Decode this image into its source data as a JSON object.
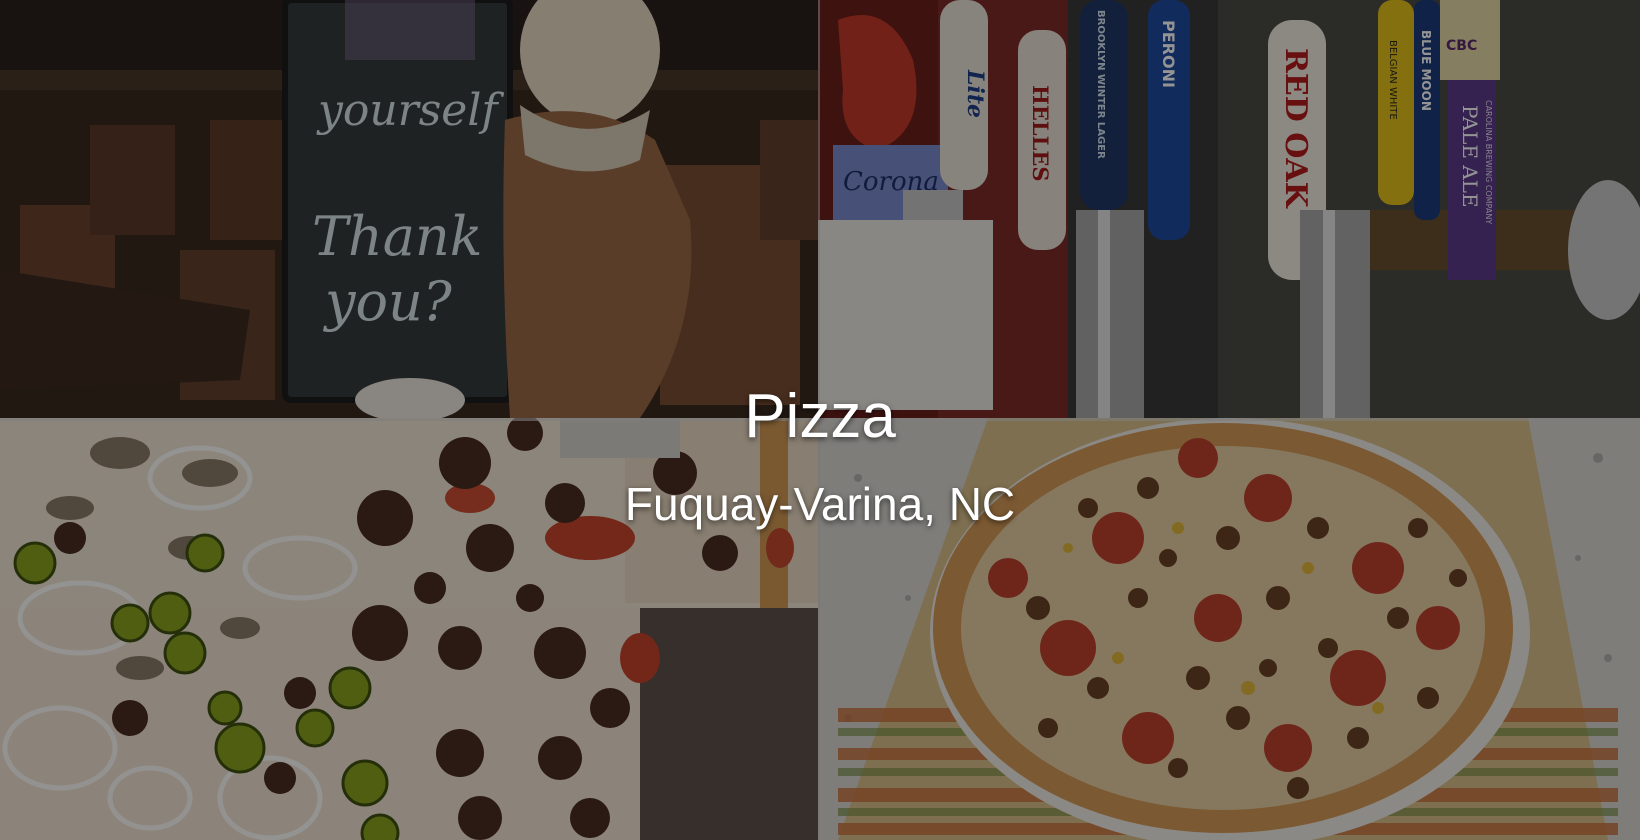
{
  "hero": {
    "title": "Pizza",
    "subtitle": "Fuquay-Varina, NC"
  },
  "photos": [
    {
      "name": "restaurant-interior",
      "chalkboard_text": [
        "yourself",
        "Thank",
        "you?"
      ]
    },
    {
      "name": "beer-taps",
      "tap_labels": [
        "Lite",
        "RED OAK",
        "HELLES",
        "BROOKLYN WINTER LAGER",
        "PERONI",
        "RED OAK",
        "BELGIAN WHITE",
        "BLUE MOON",
        "CBC",
        "PALE ALE",
        "CAROLINA BREWING COMPANY",
        "Corona"
      ]
    },
    {
      "name": "square-pizza"
    },
    {
      "name": "round-pizza"
    }
  ],
  "colors": {
    "overlay": "#000000",
    "text": "#ffffff"
  }
}
